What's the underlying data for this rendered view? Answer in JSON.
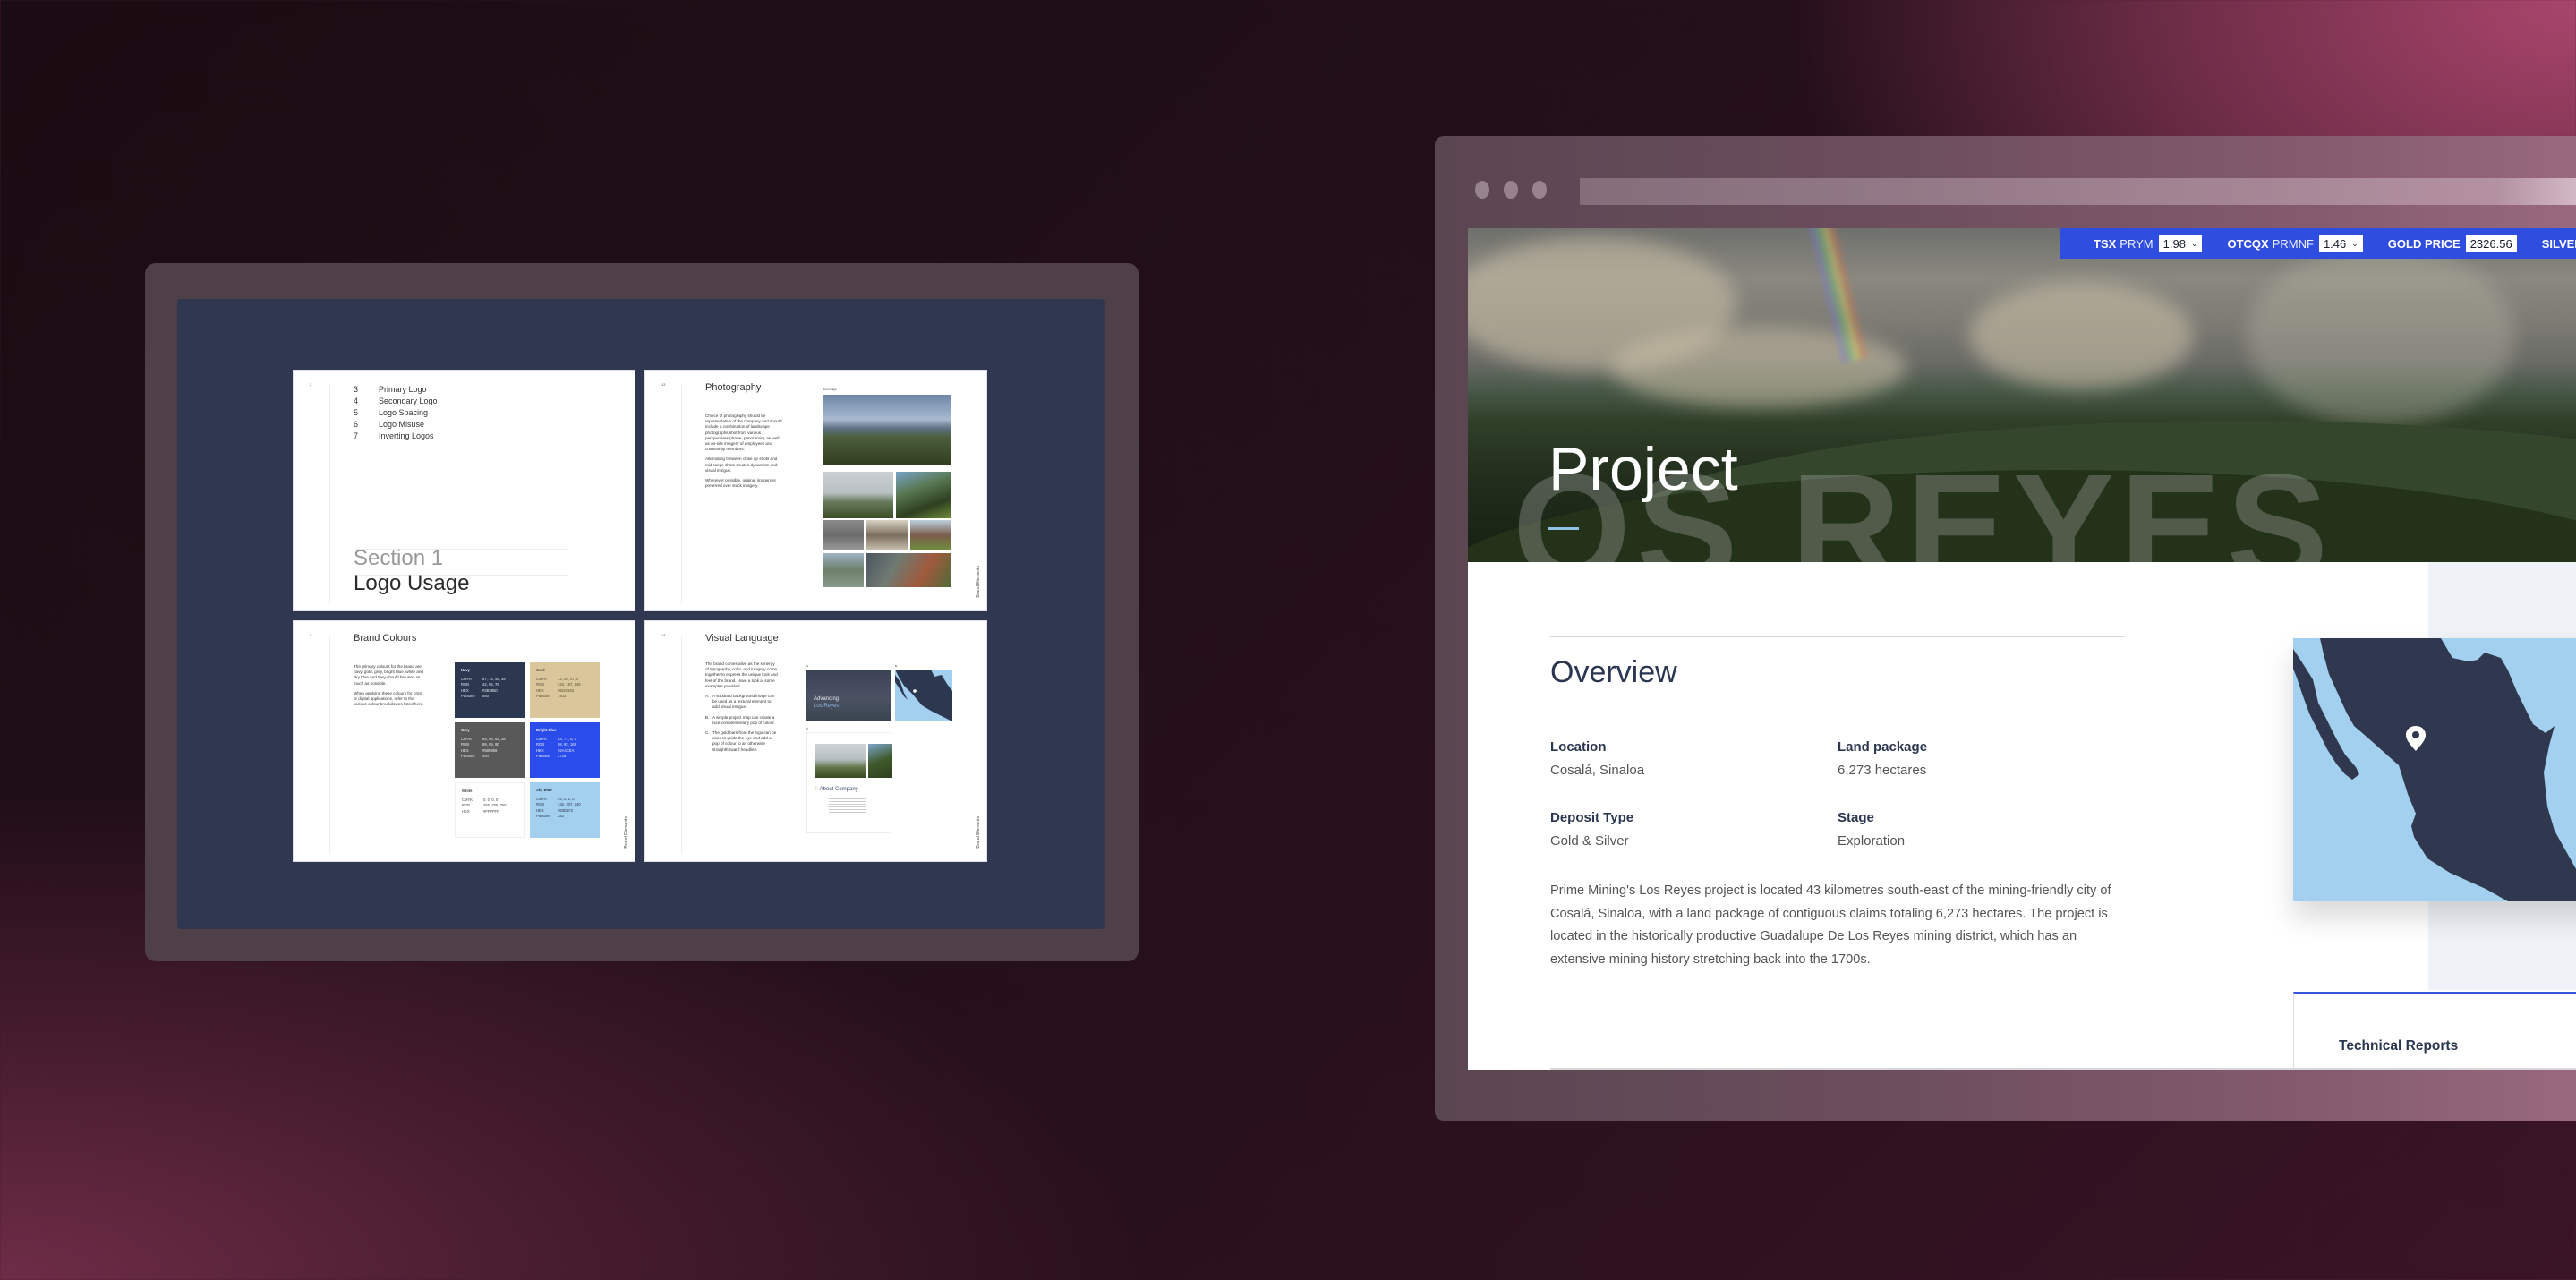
{
  "brand_book": {
    "pages": [
      {
        "page_number": "2",
        "toc": [
          {
            "num": "3",
            "label": "Primary Logo"
          },
          {
            "num": "4",
            "label": "Secondary Logo"
          },
          {
            "num": "5",
            "label": "Logo Spacing"
          },
          {
            "num": "6",
            "label": "Logo Misuse"
          },
          {
            "num": "7",
            "label": "Inverting Logos"
          }
        ],
        "section_label": "Section 1",
        "section_title": "Logo Usage"
      },
      {
        "page_number": "13",
        "title": "Photography",
        "paragraphs": [
          "Choice of photography should be representative of the company and should include a combination of landscape photographs shot from various perspectives (drone, panoramic), as well as on-site imagery of employees and community members.",
          "Alternating between close up shots and mid-range shots creates dynamism and visual intrigue.",
          "Whenever possible, original imagery is preferred over stock imagery."
        ],
        "image_caption": "Hero Image",
        "side_label": "Brand Elements"
      },
      {
        "page_number": "8",
        "title": "Brand Colours",
        "paragraphs": [
          "The primary colours for the brand are navy, gold, grey, bright blue, white and sky blue and they should be used as much as possible.",
          "When applying these colours for print or digital applications, refer to the various colour breakdowns listed here."
        ],
        "swatches": [
          {
            "name": "Navy",
            "rows": [
              [
                "CMYK",
                "87, 74, 45, 39"
              ],
              [
                "RGB",
                "42, 56, 79"
              ],
              [
                "HEX",
                "#2B3850"
              ],
              [
                "Pantone",
                "540"
              ]
            ],
            "color": "#2B3850"
          },
          {
            "name": "Gold",
            "rows": [
              [
                "CMYK",
                "13, 20, 47, 0"
              ],
              [
                "RGB",
                "222, 197, 146"
              ],
              [
                "HEX",
                "#EDC693"
              ],
              [
                "Pantone",
                "7403"
              ]
            ],
            "color": "#D9C69A"
          },
          {
            "name": "Grey",
            "rows": [
              [
                "CMYK",
                "64, 56, 53, 28"
              ],
              [
                "RGB",
                "89, 89, 90"
              ],
              [
                "HEX",
                "#585959"
              ],
              [
                "Pantone",
                "444"
              ]
            ],
            "color": "#595959"
          },
          {
            "name": "Bright Blue",
            "rows": [
              [
                "CMYK",
                "83, 71, 0, 0"
              ],
              [
                "RGB",
                "68, 92, 169"
              ],
              [
                "HEX",
                "#2A4CEA"
              ],
              [
                "Pantone",
                "2728"
              ]
            ],
            "color": "#2A4CEA"
          },
          {
            "name": "White",
            "rows": [
              [
                "CMYK",
                "0, 0, 0, 0"
              ],
              [
                "RGB",
                "255, 255, 255"
              ],
              [
                "HEX",
                "#FFFFFF"
              ]
            ],
            "color": "#FFFFFF"
          },
          {
            "name": "Sky Blue",
            "rows": [
              [
                "CMYK",
                "44, 2, 1, 0"
              ],
              [
                "RGB",
                "132, 207, 240"
              ],
              [
                "HEX",
                "#83D1F2"
              ],
              [
                "Pantone",
                "283"
              ]
            ],
            "color": "#A3D0EE"
          }
        ],
        "side_label": "Brand Elements"
      },
      {
        "page_number": "14",
        "title": "Visual Language",
        "intro": "The brand comes alive as the synergy of typography, color, and imagery come together to express the unique look and feel of the brand. Have a look at some examples provided.",
        "list": [
          {
            "marker": "A.",
            "text": "A subdued background image can be used as a textural element to add visual intrigue."
          },
          {
            "marker": "B.",
            "text": "A simple project map can create a nice complementary pop of colour."
          },
          {
            "marker": "C.",
            "text": "The gold bars from the logo can be used to guide the eye and add a pop of colour to an otherwise straightforward headline."
          }
        ],
        "example_a_line1": "Advancing",
        "example_a_line2": "Los Reyes",
        "example_c_heading": "About Company",
        "letters": [
          "A.",
          "B.",
          "C."
        ],
        "side_label": "Brand Elements"
      }
    ]
  },
  "website": {
    "ticker": [
      {
        "label": "TSX",
        "sub": "PRYM",
        "value": "1.98",
        "has_dropdown": true
      },
      {
        "label": "OTCQX",
        "sub": "PRMNF",
        "value": "1.46",
        "has_dropdown": true
      },
      {
        "label": "GOLD PRICE",
        "sub": "",
        "value": "2326.56",
        "has_dropdown": false
      },
      {
        "label": "SILVER P",
        "sub": "",
        "value": "",
        "has_dropdown": false
      }
    ],
    "hero": {
      "title": "Project",
      "background_word": "LOS REYES"
    },
    "overview": {
      "title": "Overview",
      "facts": [
        {
          "key": "Location",
          "value": "Cosalá, Sinaloa"
        },
        {
          "key": "Land package",
          "value": "6,273 hectares"
        },
        {
          "key": "Deposit Type",
          "value": "Gold & Silver"
        },
        {
          "key": "Stage",
          "value": "Exploration"
        }
      ],
      "description": "Prime Mining's Los Reyes project is located 43 kilometres south-east of the mining-friendly city of Cosalá, Sinaloa, with a land package of contiguous claims totaling 6,273 hectares. The project is located in the historically productive Guadalupe De Los Reyes mining district, which has an extensive mining history stretching back into the 1700s."
    },
    "map": {
      "marker": "map-pin-icon",
      "land_color": "#2F384E",
      "water_color": "#A3D0EE"
    },
    "technical_reports_label": "Technical Reports",
    "colors": {
      "ticker_bg": "#2F4EE0",
      "navy": "#2B3650",
      "accent_underline": "#8FC1E6"
    }
  }
}
